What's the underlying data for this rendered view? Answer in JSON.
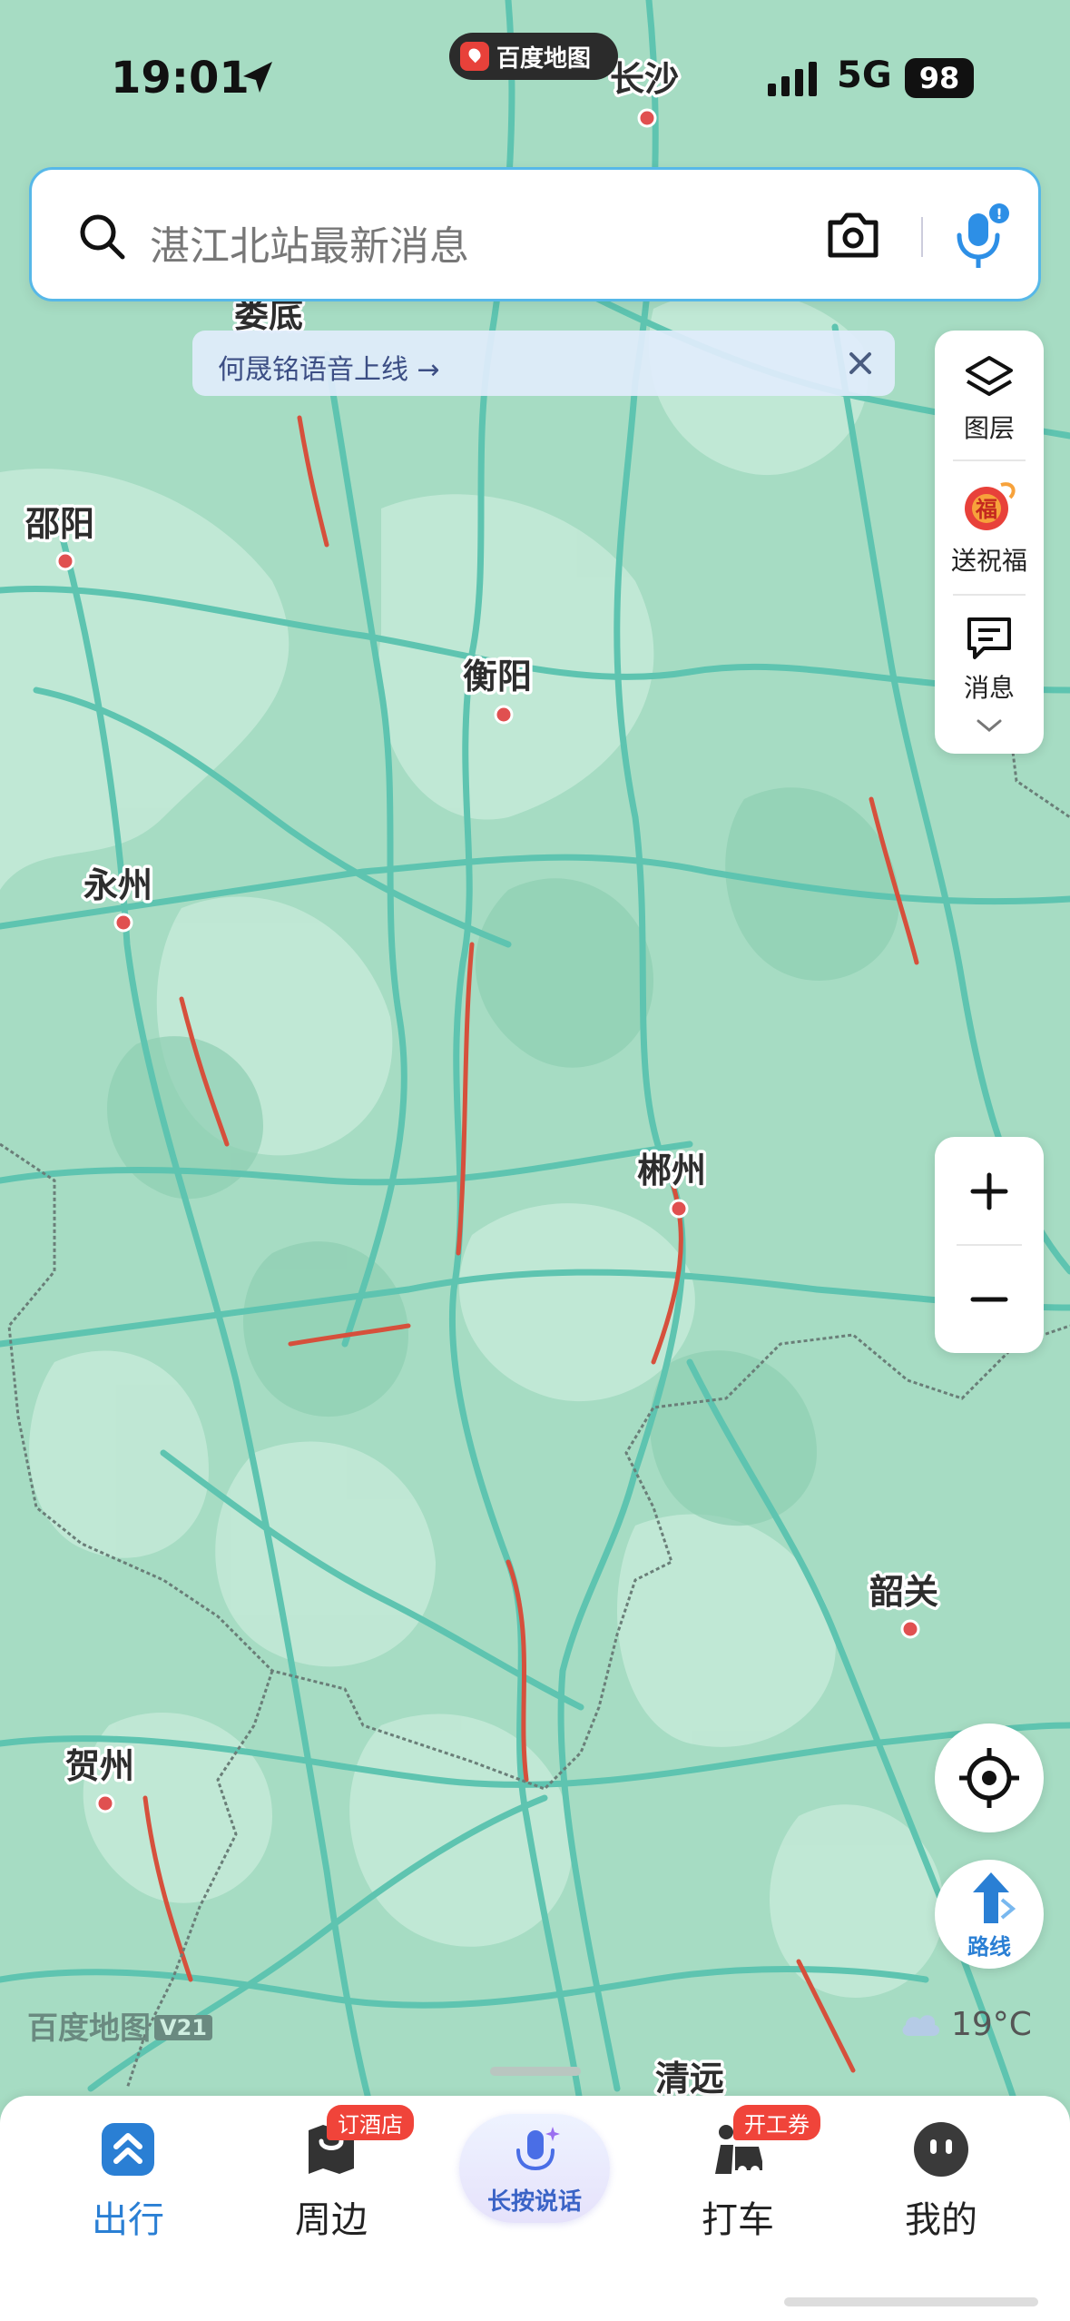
{
  "status_bar": {
    "time": "19:01",
    "app_name": "百度地图",
    "network": "5G",
    "battery": "98"
  },
  "search": {
    "placeholder": "湛江北站最新消息"
  },
  "banner": {
    "text": "何晟铭语音上线 →"
  },
  "side_panel": {
    "layers_label": "图层",
    "blessing_label": "送祝福",
    "messages_label": "消息"
  },
  "zoom": {
    "in": "+",
    "out": "−"
  },
  "route": {
    "label": "路线"
  },
  "weather": {
    "temperature": "19°C"
  },
  "watermark": {
    "brand": "百度地图",
    "version": "V21"
  },
  "map": {
    "cities": [
      {
        "name": "长沙",
        "has_dot": true
      },
      {
        "name": "娄底",
        "has_dot": false
      },
      {
        "name": "邵阳",
        "has_dot": true
      },
      {
        "name": "衡阳",
        "has_dot": true
      },
      {
        "name": "永州",
        "has_dot": true
      },
      {
        "name": "郴州",
        "has_dot": true
      },
      {
        "name": "韶关",
        "has_dot": true
      },
      {
        "name": "贺州",
        "has_dot": true
      },
      {
        "name": "清远",
        "has_dot": false
      }
    ]
  },
  "bottom_nav": {
    "items": [
      {
        "label": "出行",
        "badge": "",
        "active": true
      },
      {
        "label": "周边",
        "badge": "订酒店",
        "active": false
      },
      {
        "label": "长按说话",
        "badge": "",
        "active": false
      },
      {
        "label": "打车",
        "badge": "开工券",
        "active": false
      },
      {
        "label": "我的",
        "badge": "",
        "active": false
      }
    ]
  },
  "colors": {
    "map_base": "#a6dcc3",
    "road": "#5ec4b0",
    "accent": "#2a7fd4",
    "badge": "#f0443a"
  }
}
